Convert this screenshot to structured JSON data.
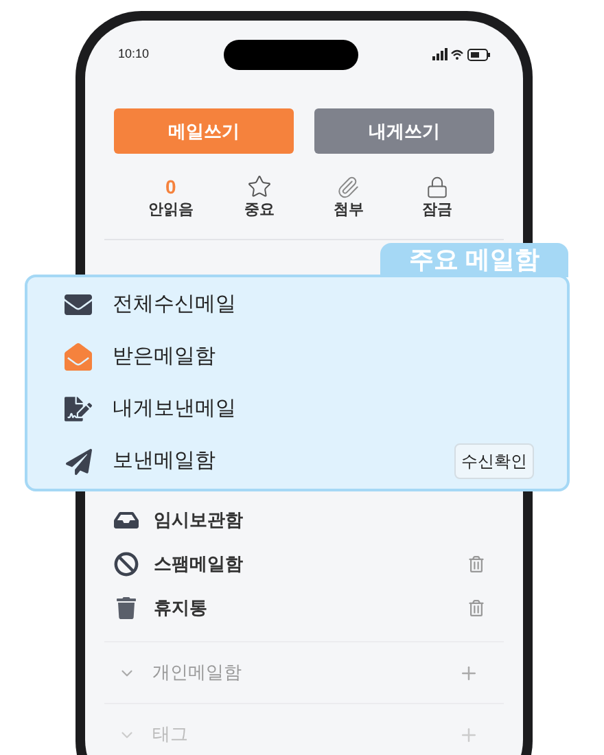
{
  "status_bar": {
    "time": "10:10"
  },
  "buttons": [
    {
      "label": "메일쓰기",
      "kind": "primary"
    },
    {
      "label": "내게쓰기",
      "kind": "secondary"
    }
  ],
  "shortcuts": [
    {
      "kind": "count",
      "value": "0",
      "label": "안읽음"
    },
    {
      "kind": "star",
      "label": "중요"
    },
    {
      "kind": "clip",
      "label": "첨부"
    },
    {
      "kind": "lock",
      "label": "잠금"
    }
  ],
  "callout": {
    "title": "주요 메일함",
    "items": [
      {
        "kind": "envelope",
        "label": "전체수신메일"
      },
      {
        "kind": "open",
        "label": "받은메일함"
      },
      {
        "kind": "note",
        "label": "내게보낸메일"
      },
      {
        "kind": "send",
        "label": "보낸메일함",
        "action": "수신확인"
      }
    ]
  },
  "folders": [
    {
      "kind": "tray",
      "label": "임시보관함",
      "empty_action": false
    },
    {
      "kind": "ban",
      "label": "스팸메일함",
      "empty_action": true
    },
    {
      "kind": "trash",
      "label": "휴지통",
      "empty_action": true
    }
  ],
  "groups": [
    {
      "label": "개인메일함"
    },
    {
      "label": "태그"
    }
  ]
}
